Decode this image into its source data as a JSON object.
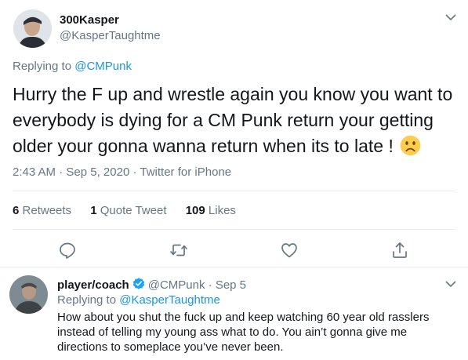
{
  "main_tweet": {
    "author_name": "300Kasper",
    "author_handle": "@KasperTaughtme",
    "replying_prefix": "Replying to",
    "replying_to": "@CMPunk",
    "text": "Hurry the F up and wrestle again you know you want to everybody is dying for a CM Punk return your getting older your gonna wanna return when its to late !",
    "emoji_icon": "slightly-frowning-face-emoji",
    "time": "2:43 AM",
    "sep": "·",
    "date": "Sep 5, 2020",
    "source": "Twitter for iPhone",
    "stats": {
      "retweets_count": "6",
      "retweets_label": "Retweets",
      "quotes_count": "1",
      "quotes_label": "Quote Tweet",
      "likes_count": "109",
      "likes_label": "Likes"
    },
    "actions": [
      "reply-icon",
      "retweet-icon",
      "like-icon",
      "share-icon"
    ]
  },
  "reply_tweet": {
    "author_name": "player/coach",
    "verified_icon": "verified-badge-icon",
    "author_handle": "@CMPunk",
    "sep": "·",
    "date": "Sep 5",
    "replying_prefix": "Replying to",
    "replying_to": "@KasperTaughtme",
    "text": "How about you shut the fuck up and keep watching 60 year old rasslers instead of telling my young ass what to do. You ain’t gonna give me directions to someplace you’ve never been."
  },
  "colors": {
    "text": "#14171a",
    "secondary": "#657786",
    "link": "#1b95e0",
    "divider": "#e6ecf0",
    "verified": "#1da1f2",
    "emoji": "#ffcc4d"
  }
}
